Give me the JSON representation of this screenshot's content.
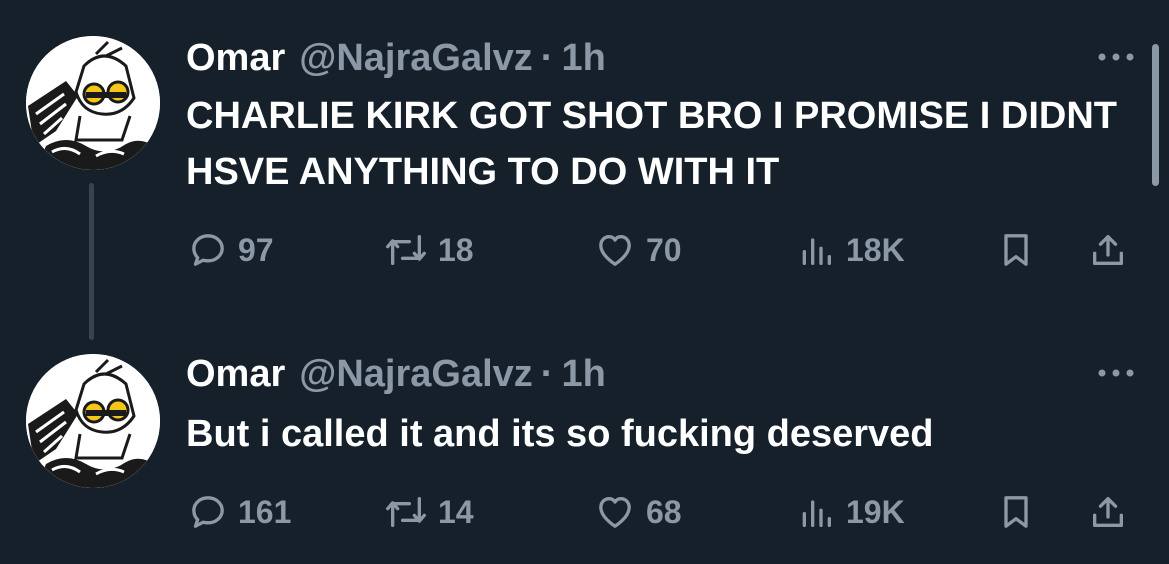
{
  "colors": {
    "background": "#15202b",
    "text_primary": "#ffffff",
    "text_secondary": "#8b98a5",
    "thread_line": "#38444d"
  },
  "tweets": [
    {
      "name": "Omar",
      "handle": "@NajraGalvz",
      "dot": "·",
      "time": "1h",
      "text": "CHARLIE KIRK GOT SHOT BRO I PROMISE I DIDNT HSVE ANYTHING TO DO WITH IT",
      "replies": "97",
      "retweets": "18",
      "likes": "70",
      "views": "18K",
      "avatar_icon": "anime-character-avatar"
    },
    {
      "name": "Omar",
      "handle": "@NajraGalvz",
      "dot": "·",
      "time": "1h",
      "text": "But i called it and its so fucking deserved",
      "replies": "161",
      "retweets": "14",
      "likes": "68",
      "views": "19K",
      "avatar_icon": "anime-character-avatar"
    }
  ]
}
